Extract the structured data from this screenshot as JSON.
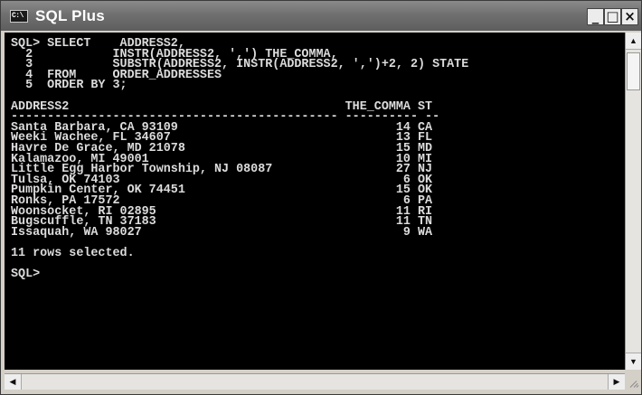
{
  "window": {
    "title": "SQL Plus",
    "icon_text": "C:\\",
    "minimize_glyph": "_",
    "maximize_glyph": "□",
    "close_glyph": "×"
  },
  "console": {
    "text": "SQL> SELECT    ADDRESS2,\n  2           INSTR(ADDRESS2, ',') THE_COMMA,\n  3           SUBSTR(ADDRESS2, INSTR(ADDRESS2, ',')+2, 2) STATE\n  4  FROM     ORDER_ADDRESSES\n  5  ORDER BY 3;\n\nADDRESS2                                      THE_COMMA ST\n--------------------------------------------- ---------- --\nSanta Barbara, CA 93109                              14 CA\nWeeki Wachee, FL 34607                               13 FL\nHavre De Grace, MD 21078                             15 MD\nKalamazoo, MI 49001                                  10 MI\nLittle Egg Harbor Township, NJ 08087                 27 NJ\nTulsa, OK 74103                                       6 OK\nPumpkin Center, OK 74451                             15 OK\nRonks, PA 17572                                       6 PA\nWoonsocket, RI 02895                                 11 RI\nBugscuffle, TN 37183                                 11 TN\nIssaquah, WA 98027                                    9 WA\n\n11 rows selected.\n\nSQL>"
  },
  "scrollbars": {
    "up_arrow": "▲",
    "down_arrow": "▼",
    "left_arrow": "◀",
    "right_arrow": "▶"
  }
}
